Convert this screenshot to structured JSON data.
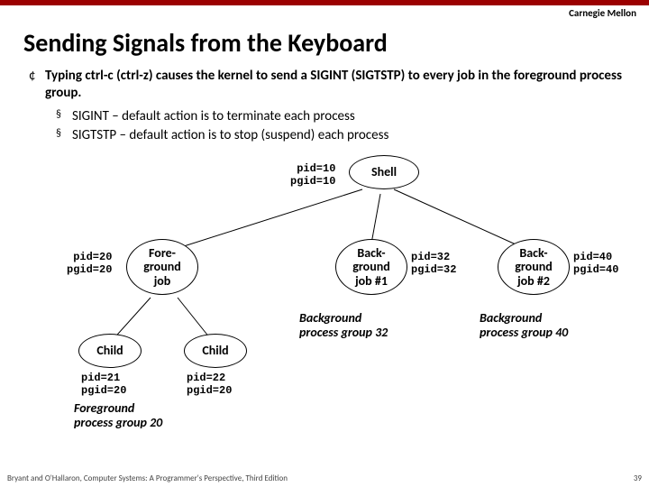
{
  "brand": "Carnegie Mellon",
  "title": "Sending Signals from the Keyboard",
  "bullet_main": "Typing ctrl-c (ctrl-z) causes the kernel to send a SIGINT (SIGTSTP) to every job in the foreground process group.",
  "sub1": "SIGINT – default action is to terminate each process",
  "sub2": "SIGTSTP – default action is to stop (suspend) each process",
  "shell_lbl_pid": "pid=10",
  "shell_lbl_pgid": "pgid=10",
  "shell": "Shell",
  "fg_lbl_pid": "pid=20",
  "fg_lbl_pgid": "pgid=20",
  "fg_l1": "Fore-",
  "fg_l2": "ground",
  "fg_l3": "job",
  "bg1_l1": "Back-",
  "bg1_l2": "ground",
  "bg1_l3": "job #1",
  "bg1_lbl_pid": "pid=32",
  "bg1_lbl_pgid": "pgid=32",
  "bg2_l1": "Back-",
  "bg2_l2": "ground",
  "bg2_l3": "job #2",
  "bg2_lbl_pid": "pid=40",
  "bg2_lbl_pgid": "pgid=40",
  "child": "Child",
  "c1_pid": "pid=21",
  "c1_pgid": "pgid=20",
  "c2_pid": "pid=22",
  "c2_pgid": "pgid=20",
  "grp_fg_l1": "Foreground",
  "grp_fg_l2": "process group 20",
  "grp32_l1": "Background",
  "grp32_l2": "process group 32",
  "grp40_l1": "Background",
  "grp40_l2": "process group 40",
  "footer_left": "Bryant and O'Hallaron, Computer Systems: A Programmer's Perspective, Third Edition",
  "footer_right": "39"
}
